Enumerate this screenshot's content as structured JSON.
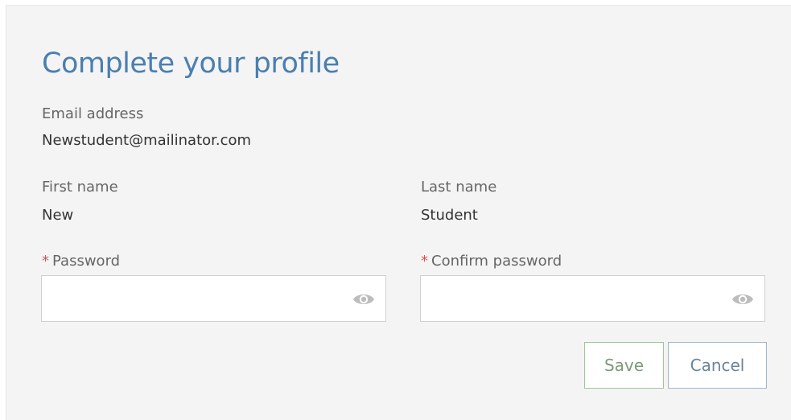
{
  "form": {
    "title": "Complete your profile",
    "email": {
      "label": "Email address",
      "value": "Newstudent@mailinator.com"
    },
    "first_name": {
      "label": "First name",
      "value": "New"
    },
    "last_name": {
      "label": "Last name",
      "value": "Student"
    },
    "password": {
      "required_marker": "*",
      "label": "Password",
      "value": "",
      "placeholder": ""
    },
    "confirm_password": {
      "required_marker": "*",
      "label": "Confirm password",
      "value": "",
      "placeholder": ""
    },
    "buttons": {
      "save_label": "Save",
      "cancel_label": "Cancel"
    },
    "icons": {
      "password_toggle": "eye-icon",
      "confirm_password_toggle": "eye-icon"
    }
  },
  "colors": {
    "title": "#4a7fb0",
    "required": "#d9534f",
    "save_border": "#9cc79a",
    "cancel_border": "#9fb7cc",
    "panel_bg": "#f4f4f4"
  }
}
